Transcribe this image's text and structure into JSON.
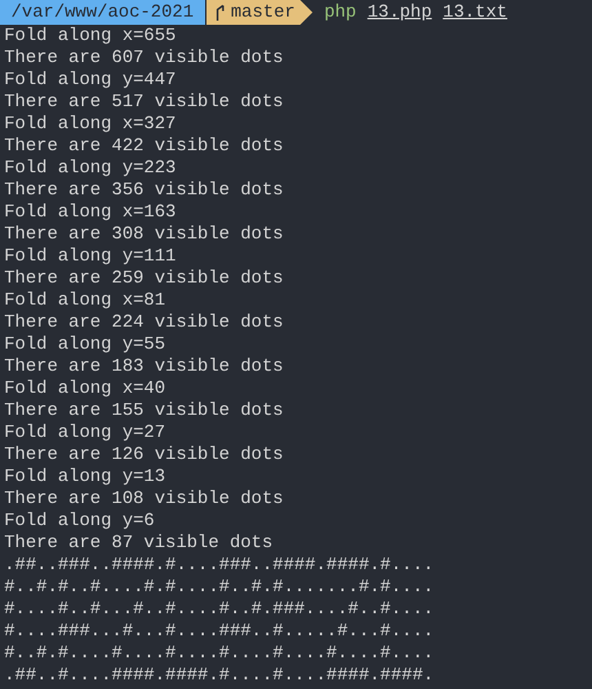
{
  "prompt": {
    "path": "/var/www/aoc-2021",
    "branch": "master",
    "command": "php",
    "args": [
      "13.php",
      "13.txt"
    ]
  },
  "output": [
    "Fold along x=655",
    "There are 607 visible dots",
    "Fold along y=447",
    "There are 517 visible dots",
    "Fold along x=327",
    "There are 422 visible dots",
    "Fold along y=223",
    "There are 356 visible dots",
    "Fold along x=163",
    "There are 308 visible dots",
    "Fold along y=111",
    "There are 259 visible dots",
    "Fold along x=81",
    "There are 224 visible dots",
    "Fold along y=55",
    "There are 183 visible dots",
    "Fold along x=40",
    "There are 155 visible dots",
    "Fold along y=27",
    "There are 126 visible dots",
    "Fold along y=13",
    "There are 108 visible dots",
    "Fold along y=6",
    "There are 87 visible dots",
    ".##..###..####.#....###..####.####.#....",
    "#..#.#..#....#.#....#..#.#.......#.#....",
    "#....#..#...#..#....#..#.###....#..#....",
    "#....###...#...#....###..#.....#...#....",
    "#..#.#....#....#....#....#....#....#....",
    ".##..#....####.####.#....#....####.####."
  ]
}
